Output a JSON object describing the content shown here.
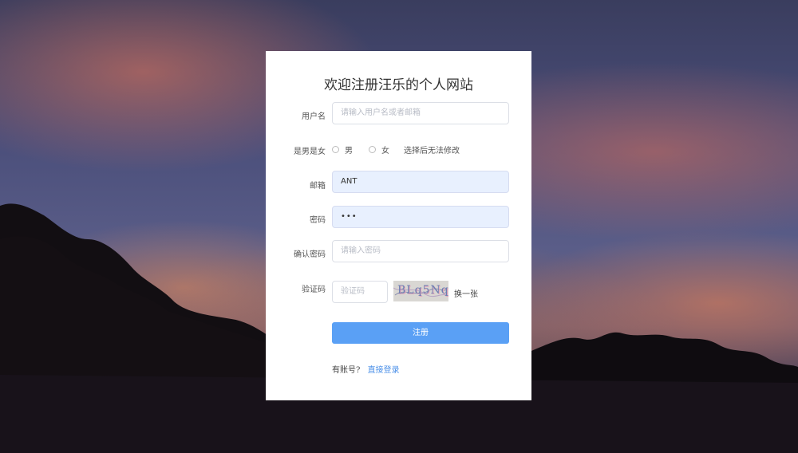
{
  "page": {
    "title": "欢迎注册汪乐的个人网站"
  },
  "form": {
    "username": {
      "label": "用户名",
      "placeholder": "请输入用户名或者邮箱",
      "value": ""
    },
    "gender": {
      "label": "是男是女",
      "options": [
        "男",
        "女"
      ],
      "note": "选择后无法修改"
    },
    "email": {
      "label": "邮箱",
      "value": "ANT"
    },
    "password": {
      "label": "密码",
      "value": "•••"
    },
    "confirm_password": {
      "label": "确认密码",
      "placeholder": "请输入密码",
      "value": ""
    },
    "captcha": {
      "label": "验证码",
      "placeholder": "验证码",
      "image_text": "BLq5Nq",
      "refresh_label": "换一张"
    },
    "submit_label": "注册"
  },
  "footer": {
    "prompt": "有账号?",
    "login_link": "直接登录"
  },
  "colors": {
    "primary": "#5aa0f5",
    "link": "#4a8fe8",
    "autofill_bg": "#e8f0fe"
  }
}
